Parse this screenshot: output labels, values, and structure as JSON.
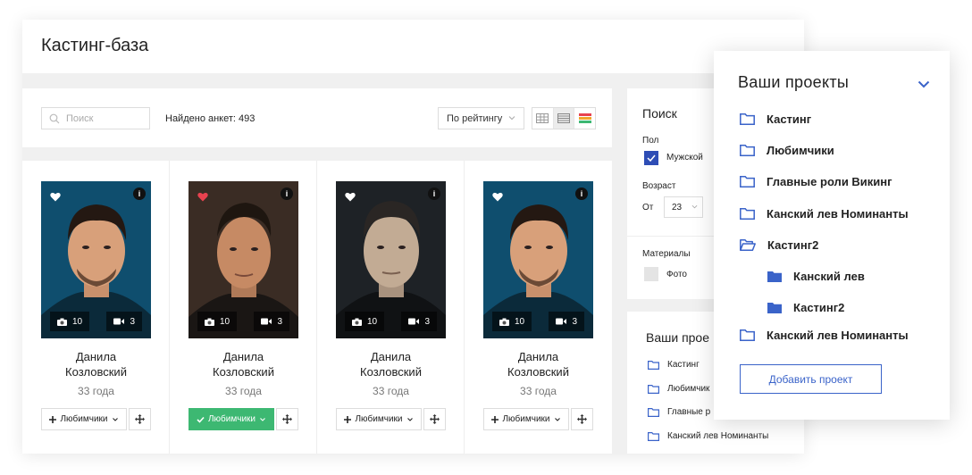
{
  "header": {
    "title": "Кастинг-база"
  },
  "toolbar": {
    "search_placeholder": "Поиск",
    "found_text": "Найдено анкет: 493",
    "sort_label": "По рейтингу",
    "view_modes": [
      "table-view-icon",
      "list-view-icon",
      "color-grid-view-icon"
    ],
    "active_view": 1
  },
  "cards": [
    {
      "first_name": "Данила",
      "last_name": "Козловский",
      "age": "33 года",
      "photos": "10",
      "videos": "3",
      "favorite_label": "Любимчики",
      "favorited": false,
      "heart_color": "#ffffff"
    },
    {
      "first_name": "Данила",
      "last_name": "Козловский",
      "age": "33 года",
      "photos": "10",
      "videos": "3",
      "favorite_label": "Любимчики",
      "favorited": true,
      "heart_color": "#e8424f"
    },
    {
      "first_name": "Данила",
      "last_name": "Козловский",
      "age": "33 года",
      "photos": "10",
      "videos": "3",
      "favorite_label": "Любимчики",
      "favorited": false,
      "heart_color": "#ffffff"
    },
    {
      "first_name": "Данила",
      "last_name": "Козловский",
      "age": "33 года",
      "photos": "10",
      "videos": "3",
      "favorite_label": "Любимчики",
      "favorited": false,
      "heart_color": "#ffffff"
    }
  ],
  "filters": {
    "title": "Поиск",
    "gender_label": "Пол",
    "gender_value": "Мужской",
    "age_label": "Возраст",
    "age_from_label": "От",
    "age_from_value": "23",
    "materials_label": "Материалы",
    "materials_photo": "Фото"
  },
  "projects_mini": {
    "title": "Ваши прое",
    "items": [
      "Кастинг",
      "Любимчик",
      "Главные р",
      "Канский лев Номинанты"
    ]
  },
  "projects_popup": {
    "title": "Ваши проекты",
    "items": [
      {
        "label": "Кастинг",
        "level": 0,
        "icon": "folder-outline-icon"
      },
      {
        "label": "Любимчики",
        "level": 0,
        "icon": "folder-outline-icon"
      },
      {
        "label": "Главные роли Викинг",
        "level": 0,
        "icon": "folder-outline-icon"
      },
      {
        "label": "Канский лев Номинанты",
        "level": 0,
        "icon": "folder-outline-icon"
      },
      {
        "label": "Кастинг2",
        "level": 0,
        "icon": "folder-open-icon"
      },
      {
        "label": "Канский лев",
        "level": 1,
        "icon": "folder-filled-icon"
      },
      {
        "label": "Кастинг2",
        "level": 1,
        "icon": "folder-filled-icon"
      },
      {
        "label": "Канский лев Номинанты",
        "level": 0,
        "icon": "folder-outline-icon"
      }
    ],
    "add_button": "Добавить проект"
  },
  "colors": {
    "accent_blue": "#3a63c9",
    "checkbox_blue": "#2e4db5",
    "favorite_green": "#3db872",
    "heart_red": "#e8424f"
  }
}
